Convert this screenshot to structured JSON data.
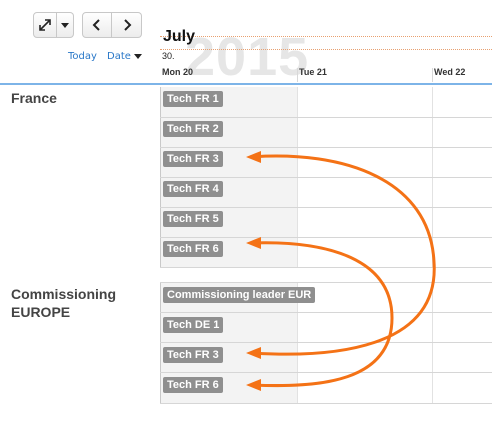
{
  "toolbar": {
    "expand_icon": "expand-arrows-icon",
    "prev_icon": "chevron-left-icon",
    "next_icon": "chevron-right-icon",
    "today_label": "Today",
    "date_label": "Date"
  },
  "timeline": {
    "month": "July",
    "year": "2015",
    "week_number": "30.",
    "days": [
      "Mon 20",
      "Tue 21",
      "Wed 22"
    ]
  },
  "groups": [
    {
      "name": "France",
      "resources": [
        "Tech FR 1",
        "Tech FR 2",
        "Tech FR 3",
        "Tech FR 4",
        "Tech FR 5",
        "Tech FR 6"
      ]
    },
    {
      "name": "Commissioning EUROPE",
      "resources": [
        "Commissioning leader EUR",
        "Tech DE 1",
        "Tech FR 3",
        "Tech FR 6"
      ]
    }
  ],
  "colors": {
    "accent_arrow": "#f47216",
    "header_rule": "#7db4e8",
    "tag_bg": "#8f8f8f",
    "link": "#2a78c8"
  }
}
